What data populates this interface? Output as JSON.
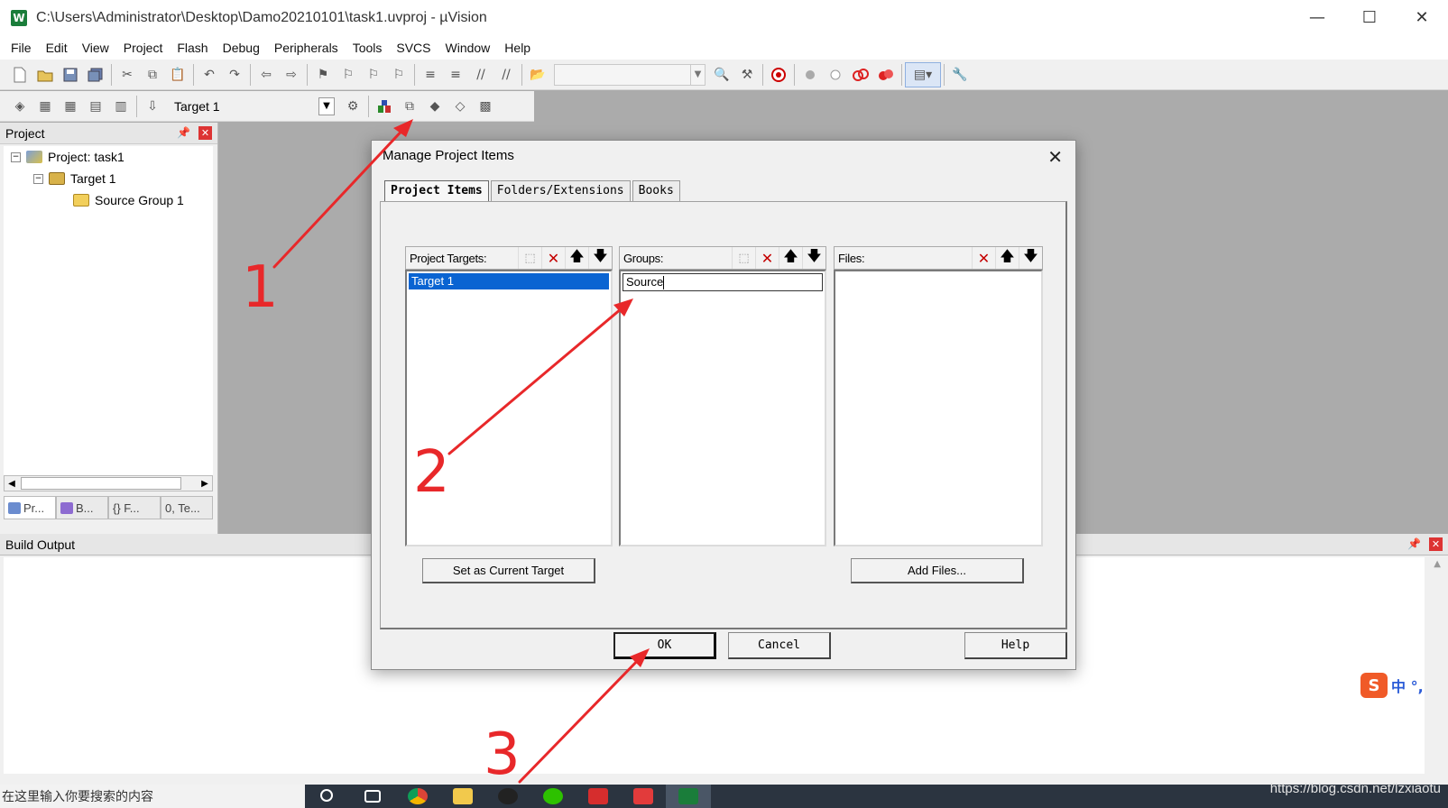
{
  "window": {
    "title": "C:\\Users\\Administrator\\Desktop\\Damo20210101\\task1.uvproj - µVision",
    "app_icon_glyph": "W",
    "minimize_glyph": "—",
    "maximize_glyph": "☐",
    "close_glyph": "✕"
  },
  "menu": [
    "File",
    "Edit",
    "View",
    "Project",
    "Flash",
    "Debug",
    "Peripherals",
    "Tools",
    "SVCS",
    "Window",
    "Help"
  ],
  "toolbar2": {
    "target_label": "Target 1"
  },
  "project_panel": {
    "title": "Project",
    "tree": {
      "project": "Project: task1",
      "target": "Target 1",
      "group": "Source Group 1"
    },
    "tabs": [
      "Pr...",
      "B...",
      "{} F...",
      "0, Te..."
    ]
  },
  "build_output": {
    "title": "Build Output"
  },
  "dialog": {
    "title": "Manage Project Items",
    "tabs": [
      "Project Items",
      "Folders/Extensions",
      "Books"
    ],
    "targets": {
      "label": "Project Targets:",
      "items": [
        "Target 1"
      ]
    },
    "groups": {
      "label": "Groups:",
      "edit_value": "Source"
    },
    "files": {
      "label": "Files:"
    },
    "set_current_target": "Set as Current Target",
    "add_files": "Add Files...",
    "ok": "OK",
    "cancel": "Cancel",
    "help": "Help"
  },
  "annotations": [
    "1",
    "2",
    "3"
  ],
  "ime": {
    "logo": "S",
    "text": "中 °,"
  },
  "taskbar": {
    "search_text": "在这里输入你要搜索的内容"
  },
  "watermark": "https://blog.csdn.net/lzxiaotu",
  "colors": {
    "selection": "#0a64d2",
    "annotation": "#e8282a",
    "delete_icon": "#c40000"
  }
}
